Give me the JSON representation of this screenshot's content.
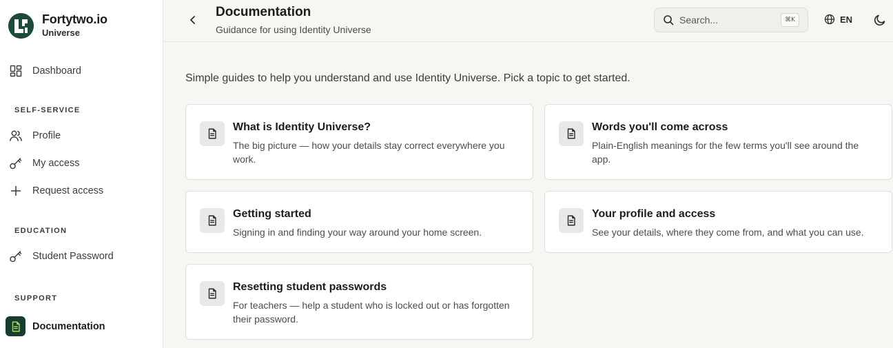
{
  "brand": {
    "name": "Fortytwo.io",
    "subtitle": "Universe"
  },
  "sidebar": {
    "dashboard": {
      "label": "Dashboard",
      "icon": "grid-icon"
    },
    "sections": [
      {
        "label": "SELF-SERVICE",
        "items": [
          {
            "label": "Profile",
            "icon": "users-icon"
          },
          {
            "label": "My access",
            "icon": "key-icon"
          },
          {
            "label": "Request access",
            "icon": "plus-icon"
          }
        ]
      },
      {
        "label": "EDUCATION",
        "items": [
          {
            "label": "Student Password",
            "icon": "key-icon"
          }
        ]
      },
      {
        "label": "SUPPORT",
        "items": [
          {
            "label": "Documentation",
            "icon": "document-icon",
            "active": true
          }
        ]
      }
    ]
  },
  "header": {
    "title": "Documentation",
    "subtitle": "Guidance for using Identity Universe",
    "search_placeholder": "Search...",
    "search_shortcut": "⌘K",
    "language": "EN"
  },
  "intro": "Simple guides to help you understand and use Identity Universe. Pick a topic to get started.",
  "cards": [
    {
      "title": "What is Identity Universe?",
      "description": "The big picture — how your details stay correct everywhere you work."
    },
    {
      "title": "Words you'll come across",
      "description": "Plain-English meanings for the few terms you'll see around the app."
    },
    {
      "title": "Getting started",
      "description": "Signing in and finding your way around your home screen."
    },
    {
      "title": "Your profile and access",
      "description": "See your details, where they come from, and what you can use."
    },
    {
      "title": "Resetting student passwords",
      "description": "For teachers — help a student who is locked out or has forgotten their password."
    }
  ],
  "colors": {
    "brand": "#1f4a3a",
    "active_bg": "#173d2c",
    "accent": "#a9d86b"
  }
}
